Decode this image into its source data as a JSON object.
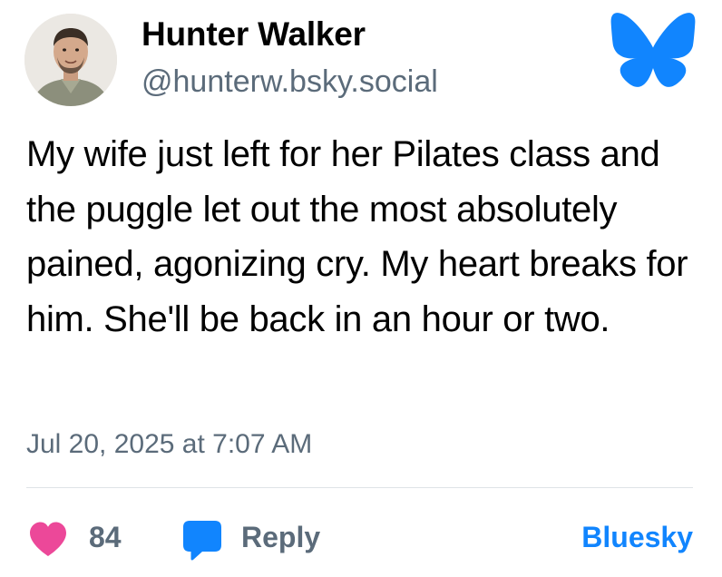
{
  "author": {
    "name": "Hunter Walker",
    "handle": "@hunterw.bsky.social",
    "avatar_icon": "profile-photo"
  },
  "post": {
    "text": "My wife just left for her Pilates class and the puggle let out the most absolutely pained, agonizing cry. My heart breaks for him. She'll be back in an hour or two.",
    "timestamp": "Jul 20, 2025 at 7:07 AM"
  },
  "actions": {
    "like_count": "84",
    "like_icon": "heart-icon",
    "reply_label": "Reply",
    "reply_icon": "speech-bubble-icon",
    "bluesky_link": "Bluesky"
  },
  "brand": {
    "logo_icon": "butterfly-icon",
    "accent_color": "#1185fe",
    "like_color": "#ec4899",
    "muted_color": "#5b6b7a"
  }
}
